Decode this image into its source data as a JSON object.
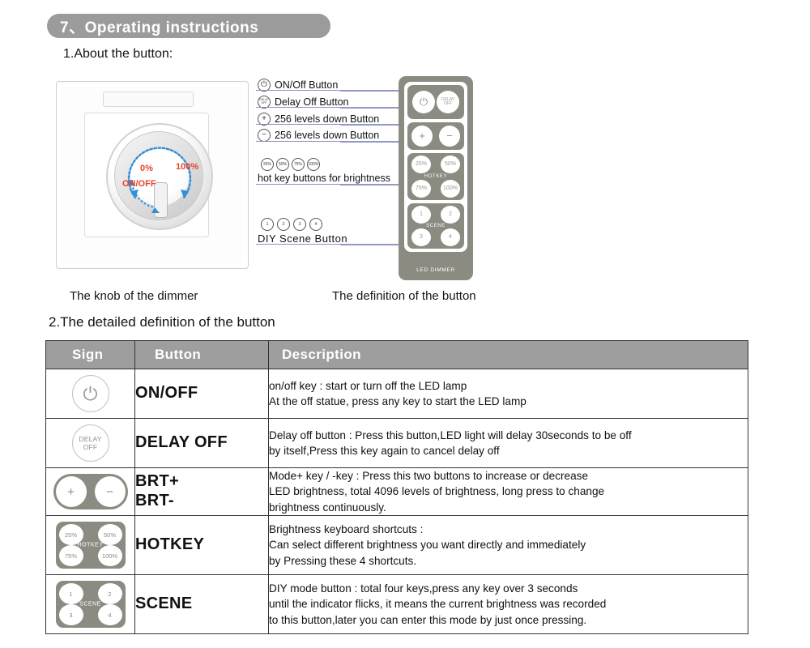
{
  "header": {
    "title": "7、Operating instructions"
  },
  "sections": {
    "sub1": "1.About the button:",
    "sub2": "2.The detailed definition of the button"
  },
  "knob_panel": {
    "labels": {
      "zero": "0%",
      "hundred": "100%",
      "onoff": "ON/OFF"
    },
    "caption": "The knob of the dimmer"
  },
  "remote": {
    "caption": "The definition of the button",
    "brand": "LED DIMMER",
    "keys": {
      "power": "⏻",
      "delay_line1": "DELAY",
      "delay_line2": "OFF",
      "plus": "+",
      "minus": "−",
      "hot_25": "25%",
      "hot_50": "50%",
      "hot_75": "75%",
      "hot_100": "100%",
      "hotkey_label": "HOTKEY",
      "scene_1": "1",
      "scene_2": "2",
      "scene_3": "3",
      "scene_4": "4",
      "scene_label": "SCENE"
    }
  },
  "callouts": [
    {
      "icon": "power-icon",
      "glyph": "⏻",
      "text": "ON/Off  Button"
    },
    {
      "icon": "delay-off-icon",
      "glyph": "DELAY OFF",
      "text": "Delay Off Button"
    },
    {
      "icon": "plus-icon",
      "glyph": "+",
      "text": "256 levels down Button"
    },
    {
      "icon": "minus-icon",
      "glyph": "−",
      "text": "256 levels down Button"
    }
  ],
  "callout_hotkey": {
    "icons": [
      "25%",
      "50%",
      "75%",
      "100%"
    ],
    "text": "hot key buttons for brightness"
  },
  "callout_scene": {
    "icons": [
      "1",
      "2",
      "3",
      "4"
    ],
    "text": "DIY  Scene  Button"
  },
  "table": {
    "headers": {
      "sign": "Sign",
      "button": "Button",
      "description": "Description"
    },
    "rows": [
      {
        "sign_type": "power",
        "sign_glyph": "⏻",
        "button": "ON/OFF",
        "desc_lines": [
          "on/off key : start or turn off the LED lamp",
          "At the off statue, press any key to start the LED lamp"
        ]
      },
      {
        "sign_type": "delay",
        "sign_line1": "DELAY",
        "sign_line2": "OFF",
        "button": "DELAY OFF",
        "desc_lines": [
          "Delay off button : Press this button,LED light will delay 30seconds to be off",
          " by itself,Press  this  key  again  to  cancel  delay  off"
        ]
      },
      {
        "sign_type": "capsule",
        "sign_plus": "+",
        "sign_minus": "−",
        "button_line1": "BRT+",
        "button_line2": "BRT-",
        "desc_lines": [
          "Mode+ key / -key : Press this two buttons to increase or decrease",
          "LED brightness, total 4096 levels of brightness, long press  to  change",
          "brightness continuously."
        ]
      },
      {
        "sign_type": "quad",
        "sign_keys": [
          "25%",
          "50%",
          "75%",
          "100%"
        ],
        "sign_label": "HOTKEY",
        "button": "HOTKEY",
        "desc_lines": [
          "Brightness keyboard shortcuts :",
          "Can select different brightness you want directly and immediately",
          "by Pressing these 4 shortcuts."
        ]
      },
      {
        "sign_type": "quad",
        "sign_keys": [
          "1",
          "2",
          "3",
          "4"
        ],
        "sign_label": "SCENE",
        "button": "SCENE",
        "desc_lines": [
          "DIY mode button : total four keys,press any key over 3 seconds",
          "until the indicator flicks, it means the current brightness was recorded",
          "to this button,later you can enter this mode by just once pressing."
        ]
      }
    ]
  },
  "colors": {
    "header_pill": "#9b9b9b",
    "table_header": "#9e9e9e",
    "device_body": "#8b8b82",
    "connector": "#9297c9",
    "knob_label_red": "#e8432a",
    "knob_arc_blue": "#2f8fd8"
  }
}
